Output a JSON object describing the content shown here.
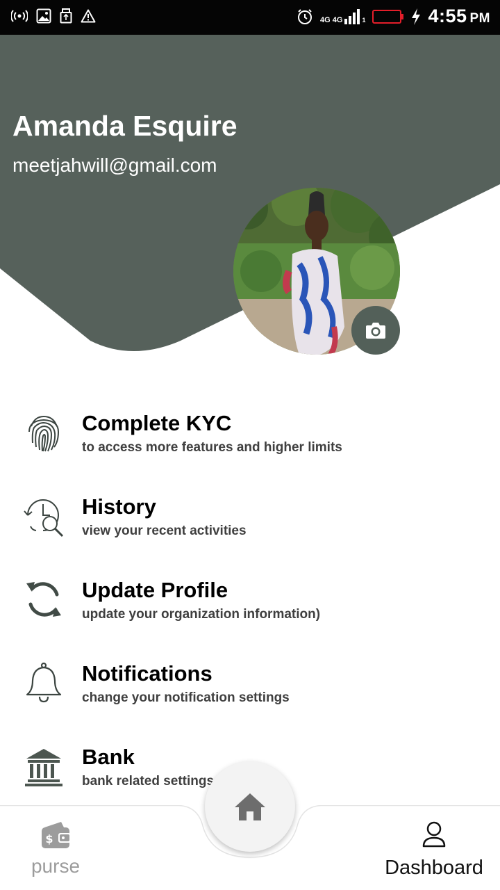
{
  "status_bar": {
    "time": "4:55",
    "ampm": "PM",
    "network_top": "4G 4G",
    "sim_slot": "1",
    "icons": [
      "hotspot-icon",
      "image-icon",
      "usb-icon",
      "warning-icon",
      "alarm-icon",
      "signal-icon",
      "battery-icon",
      "charging-icon"
    ]
  },
  "profile": {
    "name": "Amanda Esquire",
    "email": "meetjahwill@gmail.com"
  },
  "menu": {
    "items": [
      {
        "icon": "fingerprint-icon",
        "title": "Complete KYC",
        "subtitle": "to access more features and higher limits"
      },
      {
        "icon": "history-icon",
        "title": "History",
        "subtitle": "view your recent activities"
      },
      {
        "icon": "sync-icon",
        "title": "Update Profile",
        "subtitle": "update your organization information)"
      },
      {
        "icon": "bell-icon",
        "title": "Notifications",
        "subtitle": "change your notification settings"
      },
      {
        "icon": "bank-icon",
        "title": "Bank",
        "subtitle": "bank related settings"
      }
    ]
  },
  "bottom_nav": {
    "purse_label": "purse",
    "dashboard_label": "Dashboard"
  },
  "colors": {
    "header": "#56615b",
    "icon": "#4c5650",
    "inactive": "#9c9c9c"
  }
}
